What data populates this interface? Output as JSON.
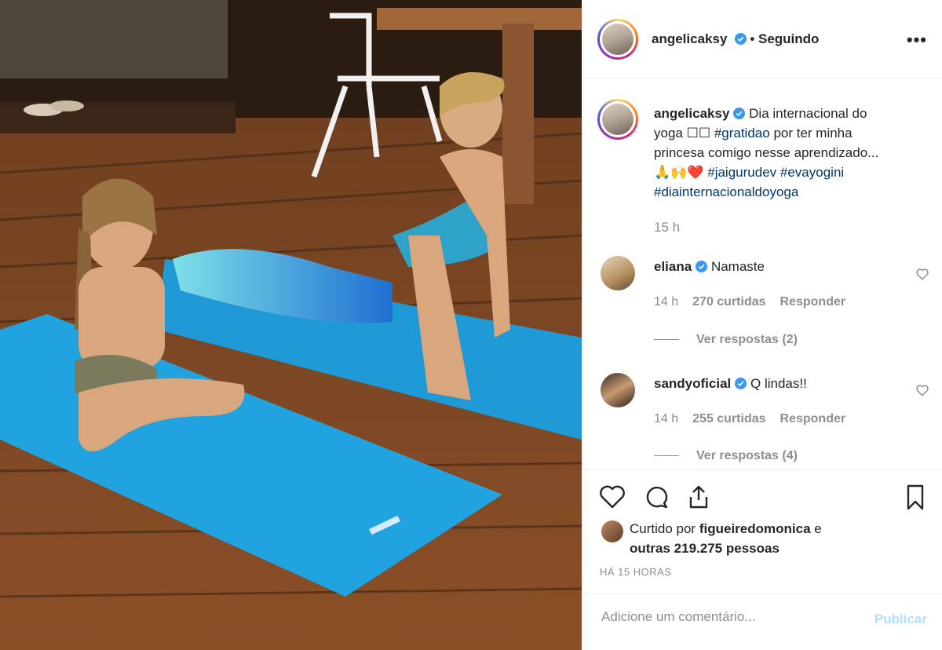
{
  "post": {
    "username": "angelicaksy",
    "follow_status": "• Seguindo",
    "more_label": "•••",
    "caption": {
      "line1": "Dia internacional do",
      "line2_start": "yoga ☐☐",
      "hashtag_gratidao": "#gratidao",
      "line2_end": "por ter minha",
      "line3": "princesa comigo nesse aprendizado...",
      "emojis": "🙏🙌❤️",
      "hashtag_jaigurudev": "#jaigurudev",
      "hashtag_evayogini": "#evayogini",
      "hashtag_dia": "#diainternacionaldoyoga",
      "time": "15 h"
    },
    "comments": [
      {
        "username": "eliana",
        "text": "Namaste",
        "time": "14 h",
        "likes": "270 curtidas",
        "reply": "Responder",
        "view_replies": "Ver respostas (2)"
      },
      {
        "username": "sandyoficial",
        "text": "Q lindas!!",
        "time": "14 h",
        "likes": "255 curtidas",
        "reply": "Responder",
        "view_replies": "Ver respostas (4)"
      }
    ],
    "liked_by": {
      "prefix": "Curtido por",
      "user": "figueiredomonica",
      "suffix": "e",
      "others": "outras 219.275 pessoas"
    },
    "posted_ago": "HÁ 15 HORAS",
    "comment_placeholder": "Adicione um comentário...",
    "publish_label": "Publicar"
  },
  "colors": {
    "verified": "#3897f0",
    "hashtag": "#00376b",
    "muted": "#8e8e8e",
    "publish_disabled": "#b2dffc",
    "mat": "#1f9ad6"
  }
}
